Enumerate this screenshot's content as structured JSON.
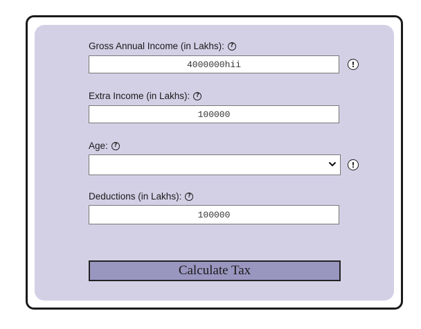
{
  "form": {
    "gross_income": {
      "label": "Gross Annual Income (in Lakhs):",
      "value": "4000000hii",
      "help_icon": "question-circle-icon",
      "warning_icon": "exclamation-circle-icon"
    },
    "extra_income": {
      "label": "Extra Income (in Lakhs):",
      "value": "100000",
      "help_icon": "question-circle-icon"
    },
    "age": {
      "label": "Age:",
      "selected_value": "",
      "help_icon": "question-circle-icon",
      "dropdown_icon": "chevron-down-icon",
      "warning_icon": "exclamation-circle-icon"
    },
    "deductions": {
      "label": "Deductions (in Lakhs):",
      "value": "100000",
      "help_icon": "question-circle-icon"
    },
    "submit_label": "Calculate Tax"
  },
  "colors": {
    "panel_background": "#d3d0e6",
    "button_background": "#9997c0",
    "frame_border": "#1a1a1a"
  }
}
